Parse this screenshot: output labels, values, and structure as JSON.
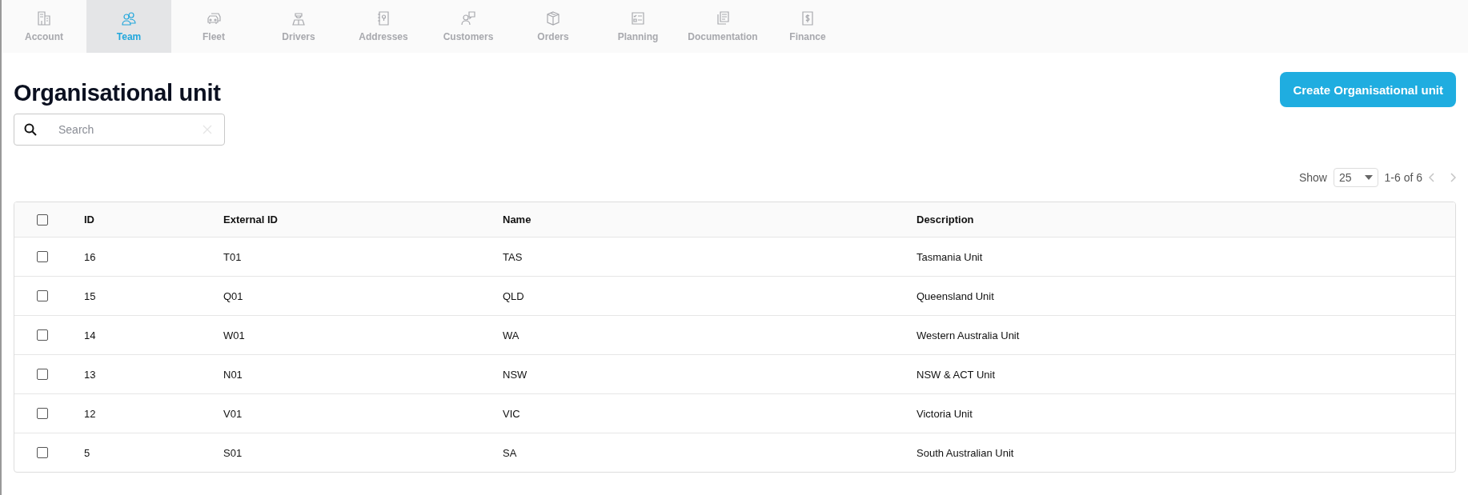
{
  "tabs": [
    {
      "label": "Account",
      "selected": false
    },
    {
      "label": "Team",
      "selected": true
    },
    {
      "label": "Fleet",
      "selected": false
    },
    {
      "label": "Drivers",
      "selected": false
    },
    {
      "label": "Addresses",
      "selected": false
    },
    {
      "label": "Customers",
      "selected": false
    },
    {
      "label": "Orders",
      "selected": false
    },
    {
      "label": "Planning",
      "selected": false
    },
    {
      "label": "Documentation",
      "selected": false
    },
    {
      "label": "Finance",
      "selected": false
    }
  ],
  "page_title": "Organisational unit",
  "create_button": "Create Organisational unit",
  "search": {
    "placeholder": "Search"
  },
  "pagination": {
    "show_label": "Show",
    "page_size": "25",
    "range": "1-6 of 6"
  },
  "table": {
    "select_all_checked": false,
    "columns": [
      "ID",
      "External ID",
      "Name",
      "Description"
    ],
    "rows": [
      {
        "checked": false,
        "cells": [
          "16",
          "T01",
          "TAS",
          "Tasmania Unit"
        ]
      },
      {
        "checked": false,
        "cells": [
          "15",
          "Q01",
          "QLD",
          "Queensland Unit"
        ]
      },
      {
        "checked": false,
        "cells": [
          "14",
          "W01",
          "WA",
          "Western Australia Unit"
        ]
      },
      {
        "checked": false,
        "cells": [
          "13",
          "N01",
          "NSW",
          "NSW & ACT Unit"
        ]
      },
      {
        "checked": false,
        "cells": [
          "12",
          "V01",
          "VIC",
          "Victoria Unit"
        ]
      },
      {
        "checked": false,
        "cells": [
          "5",
          "S01",
          "SA",
          "South Australian Unit"
        ]
      }
    ]
  }
}
